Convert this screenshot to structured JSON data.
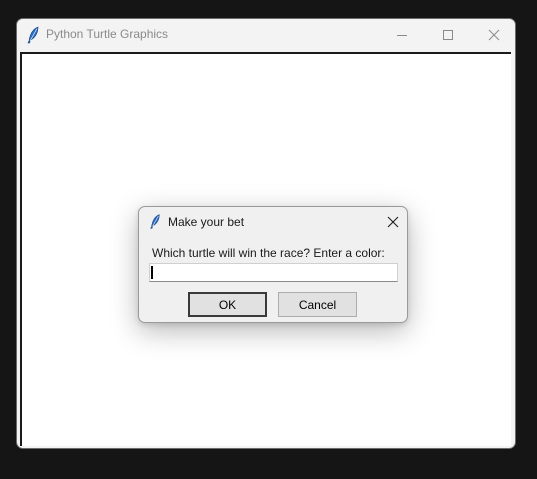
{
  "main_window": {
    "title": "Python Turtle Graphics",
    "app_icon": "feather-icon",
    "controls": {
      "minimize_icon": "minimize-icon",
      "maximize_icon": "maximize-icon",
      "close_icon": "close-icon"
    }
  },
  "dialog": {
    "title": "Make your bet",
    "app_icon": "feather-icon",
    "close_icon": "close-icon",
    "prompt": "Which turtle will win the race? Enter a color:",
    "input_value": "",
    "ok_label": "OK",
    "cancel_label": "Cancel"
  },
  "colors": {
    "desktop_bg": "#151515",
    "window_bg": "#f3f3f3",
    "canvas_bg": "#ffffff",
    "dialog_bg": "#f0f0f0",
    "button_bg": "#e1e1e1",
    "feather_blue": "#1f5fb3"
  }
}
